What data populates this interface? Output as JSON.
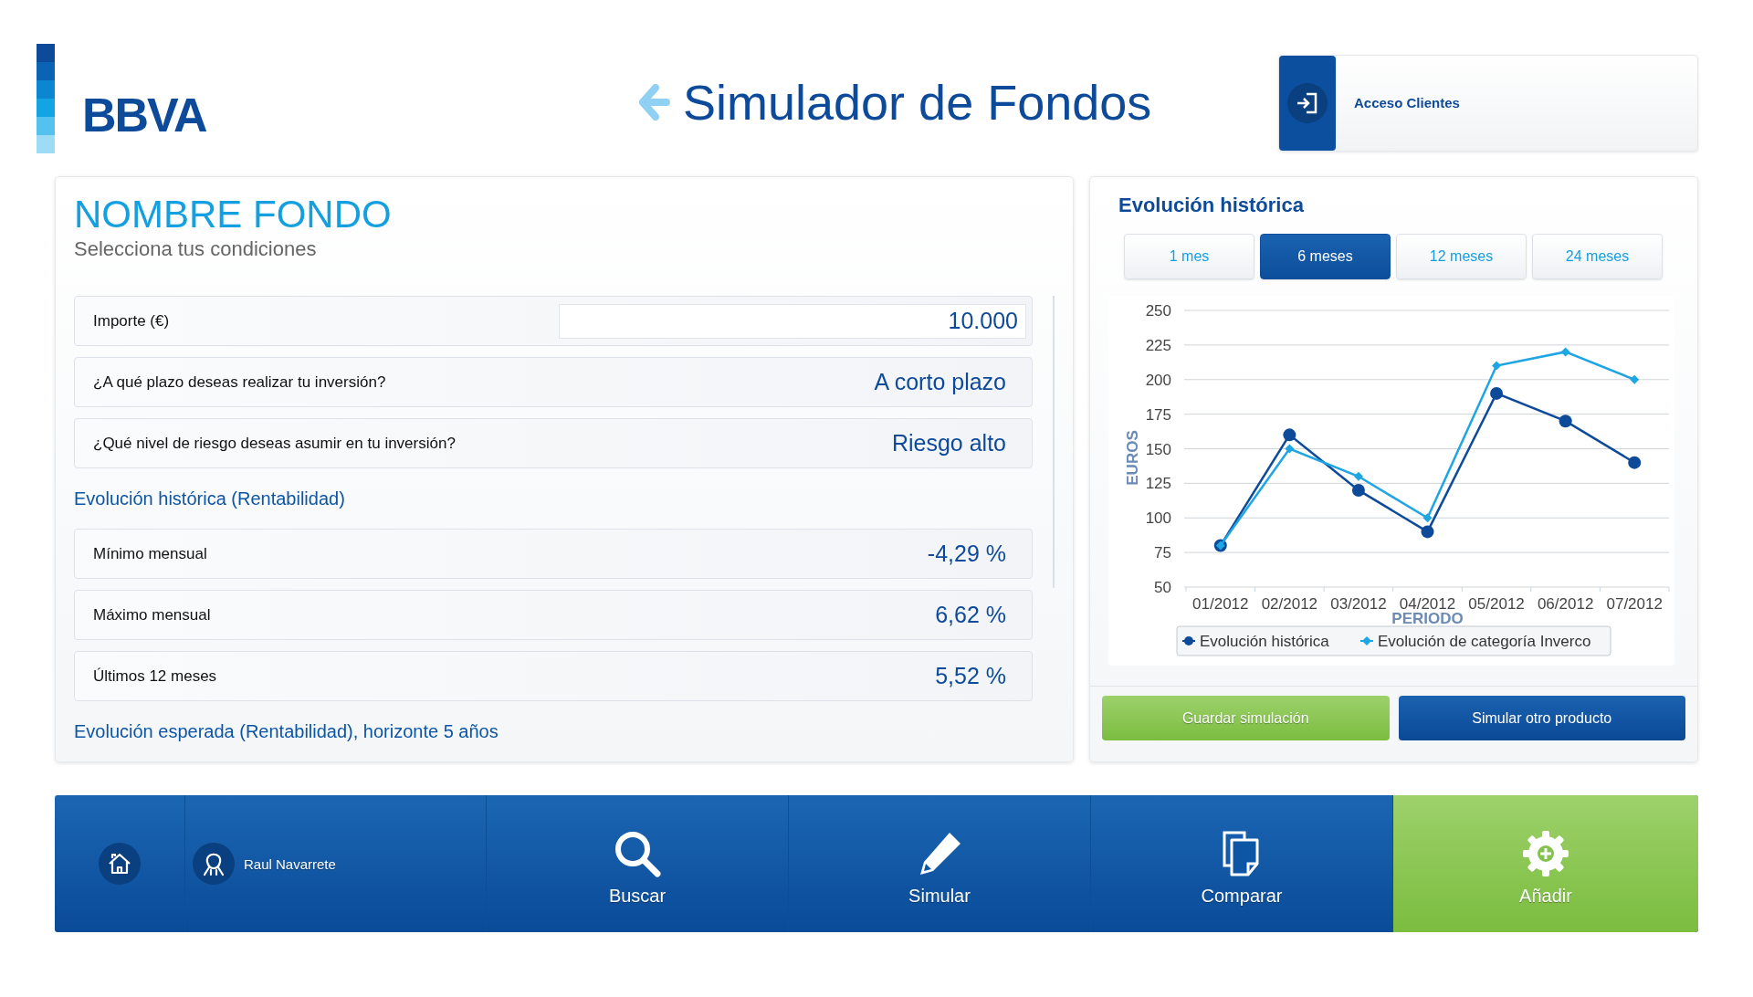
{
  "logo": {
    "text": "BBVA"
  },
  "header": {
    "title": "Simulador de Fondos",
    "login_button": "Acceso Clientes"
  },
  "fund": {
    "title": "NOMBRE FONDO",
    "subtitle": "Selecciona tus condiciones",
    "conditions": [
      {
        "kind": "input",
        "label": "Importe (€)",
        "value": "10.000"
      },
      {
        "kind": "select",
        "label": "¿A qué plazo deseas realizar tu inversión?",
        "value": "A corto plazo"
      },
      {
        "kind": "select",
        "label": "¿Qué nivel de riesgo deseas asumir en tu inversión?",
        "value": "Riesgo alto"
      }
    ],
    "sections": [
      {
        "heading": "Evolución histórica (Rentabilidad)",
        "rows": [
          {
            "label": "Mínimo mensual",
            "value": "-4,29 %"
          },
          {
            "label": "Máximo mensual",
            "value": "6,62 %"
          },
          {
            "label": "Últimos 12 meses",
            "value": "5,52 %"
          }
        ]
      },
      {
        "heading": "Evolución esperada (Rentabilidad), horizonte 5 años"
      }
    ]
  },
  "history": {
    "title": "Evolución histórica",
    "periods": [
      {
        "label": "1 mes",
        "selected": false
      },
      {
        "label": "6 meses",
        "selected": true
      },
      {
        "label": "12 meses",
        "selected": false
      },
      {
        "label": "24 meses",
        "selected": false
      }
    ],
    "chart_data": {
      "type": "line",
      "xlabel": "PERIODO",
      "ylabel": "EUROS",
      "categories": [
        "01/2012",
        "02/2012",
        "03/2012",
        "04/2012",
        "05/2012",
        "06/2012",
        "07/2012"
      ],
      "series": [
        {
          "name": "Evolución histórica",
          "color": "#0d4a9a",
          "marker": "circle",
          "values": [
            80,
            160,
            120,
            90,
            190,
            170,
            140
          ]
        },
        {
          "name": "Evolución de categoría Inverco",
          "color": "#1ea5e3",
          "marker": "diamond",
          "values": [
            80,
            150,
            130,
            100,
            210,
            220,
            200
          ]
        }
      ],
      "grid": true,
      "legend": true,
      "ylim": [
        50,
        250
      ],
      "yticks": [
        50,
        75,
        100,
        125,
        150,
        175,
        200,
        225,
        250
      ]
    }
  },
  "actions": [
    {
      "kind": "save",
      "label": "Guardar simulación"
    },
    {
      "kind": "primary",
      "label": "Simular otro producto"
    }
  ],
  "nav": [
    {
      "kind": "home"
    },
    {
      "kind": "user",
      "label": "Raul Navarrete"
    },
    {
      "kind": "search",
      "label": "Buscar"
    },
    {
      "kind": "simulate",
      "label": "Simular"
    },
    {
      "kind": "compare",
      "label": "Comparar"
    },
    {
      "kind": "add",
      "label": "Añadir"
    }
  ]
}
